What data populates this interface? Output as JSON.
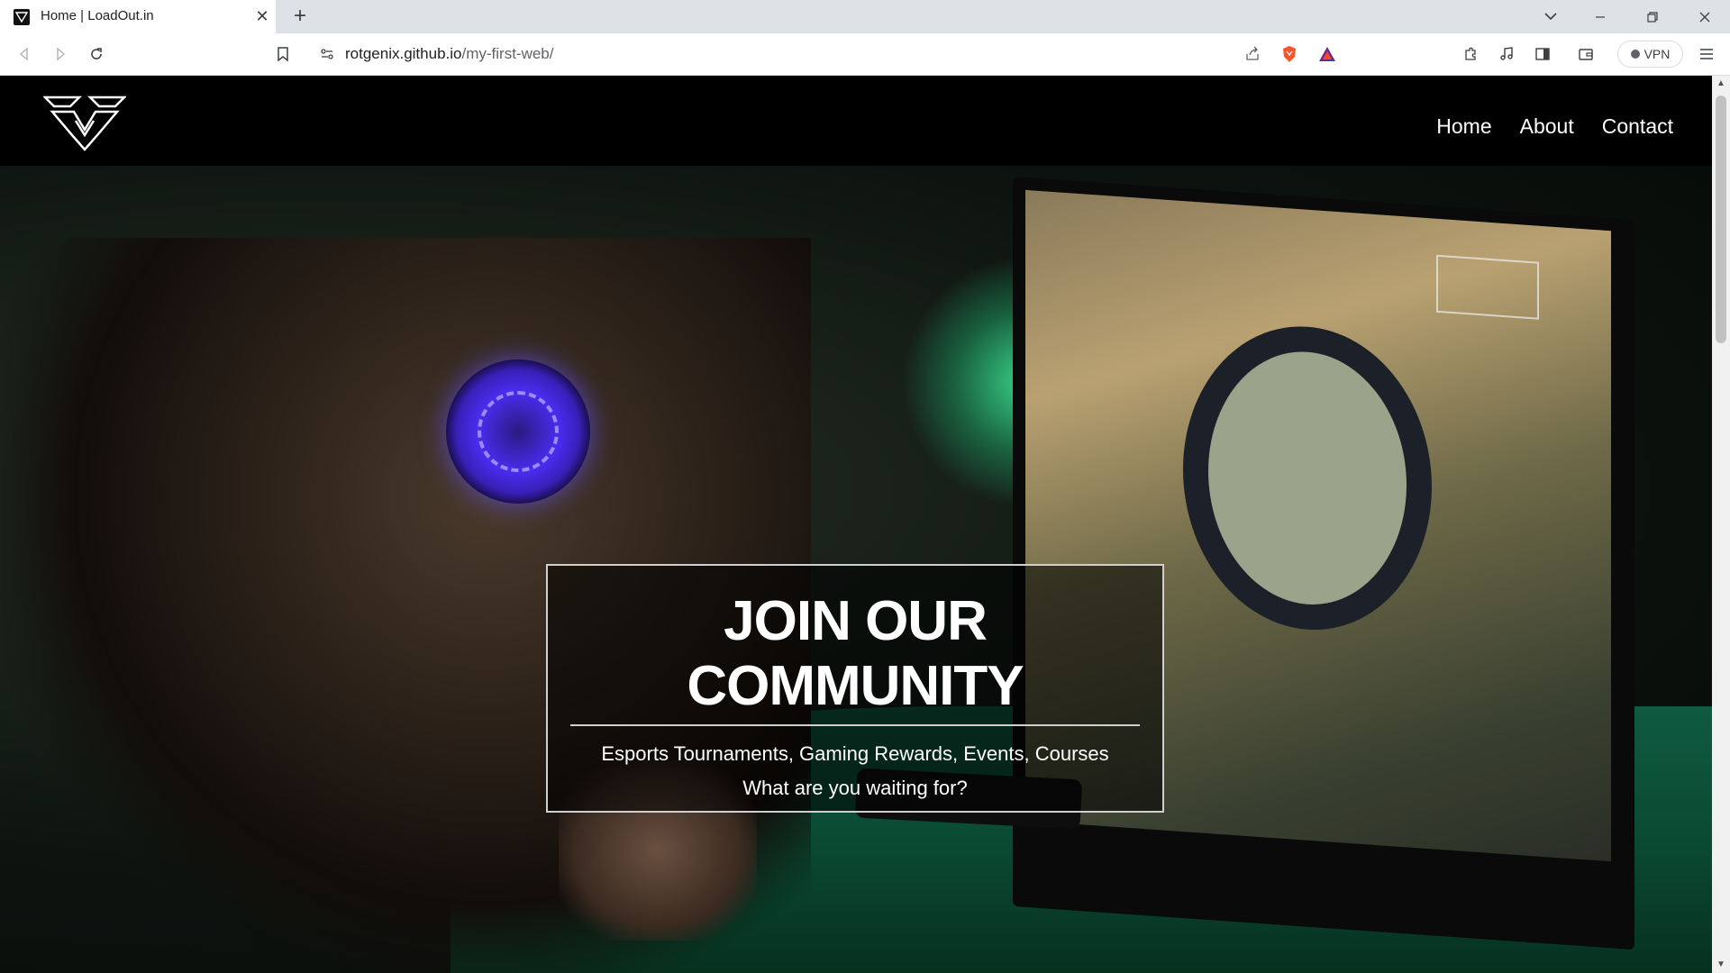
{
  "browser": {
    "tab": {
      "title": "Home | LoadOut.in",
      "favicon": "loadout-logo-icon"
    },
    "url": {
      "host": "rotgenix.github.io",
      "path": "/my-first-web/"
    },
    "vpn_label": "VPN",
    "colors": {
      "tabbar": "#dee1e6",
      "toolbar": "#ffffff",
      "brave_orange": "#fb542b"
    }
  },
  "site": {
    "nav": [
      "Home",
      "About",
      "Contact"
    ],
    "hero": {
      "title_line1": "JOIN OUR",
      "title_line2": "COMMUNITY",
      "subtitle": "Esports Tournaments, Gaming Rewards, Events, Courses",
      "cta_text": "What are you waiting for?"
    },
    "colors": {
      "background": "#000000",
      "text": "#ffffff",
      "card_border": "#cfcfcf"
    }
  }
}
